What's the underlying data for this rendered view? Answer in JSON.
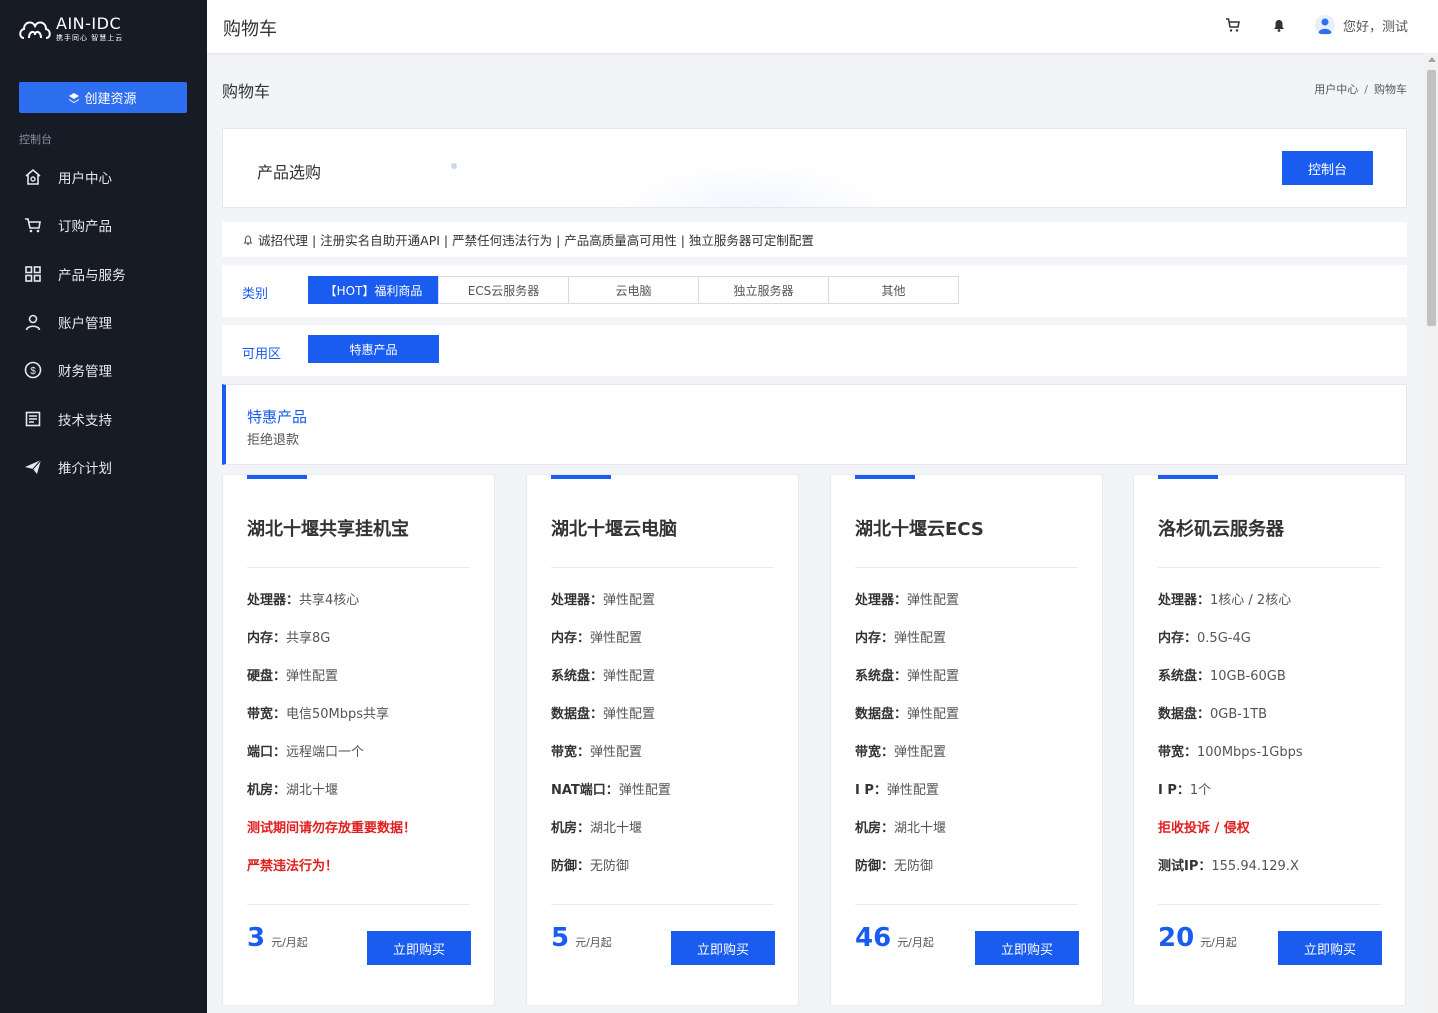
{
  "brand": {
    "title": "AIN-IDC",
    "subtitle": "携手同心 智慧上云"
  },
  "sidebar": {
    "create_label": "创建资源",
    "section": "控制台",
    "items": [
      {
        "label": "用户中心",
        "icon": "home-icon"
      },
      {
        "label": "订购产品",
        "icon": "cart-icon"
      },
      {
        "label": "产品与服务",
        "icon": "grid-icon"
      },
      {
        "label": "账户管理",
        "icon": "user-icon"
      },
      {
        "label": "财务管理",
        "icon": "dollar-icon"
      },
      {
        "label": "技术支持",
        "icon": "document-icon"
      },
      {
        "label": "推介计划",
        "icon": "send-icon"
      }
    ]
  },
  "header": {
    "title": "购物车",
    "greeting": "您好，测试"
  },
  "page": {
    "title": "购物车",
    "breadcrumb": [
      "用户中心",
      "购物车"
    ],
    "breadcrumb_sep": "/"
  },
  "product_select": {
    "title": "产品选购",
    "console_label": "控制台"
  },
  "notice": "诚招代理 | 注册实名自助开通API | 严禁任何违法行为 | 产品高质量高可用性 | 独立服务器可定制配置",
  "category": {
    "label": "类别",
    "tabs": [
      "【HOT】福利商品",
      "ECS云服务器",
      "云电脑",
      "独立服务器",
      "其他"
    ],
    "active": 0
  },
  "zone": {
    "label": "可用区",
    "tabs": [
      "特惠产品"
    ],
    "active": 0
  },
  "desc": {
    "title": "特惠产品",
    "subtitle": "拒绝退款"
  },
  "buy_label": "立即购买",
  "price_unit": "元/月起",
  "cards": [
    {
      "name": "湖北十堰共享挂机宝",
      "specs": [
        {
          "k": "处理器：",
          "v": "共享4核心"
        },
        {
          "k": "内存：",
          "v": "共享8G"
        },
        {
          "k": "硬盘：",
          "v": "弹性配置"
        },
        {
          "k": "带宽：",
          "v": "电信50Mbps共享"
        },
        {
          "k": "端口：",
          "v": "远程端口一个"
        },
        {
          "k": "机房：",
          "v": "湖北十堰"
        },
        {
          "red": "测试期间请勿存放重要数据！"
        },
        {
          "red": "严禁违法行为！"
        }
      ],
      "price": "3"
    },
    {
      "name": "湖北十堰云电脑",
      "specs": [
        {
          "k": "处理器：",
          "v": "弹性配置"
        },
        {
          "k": "内存：",
          "v": "弹性配置"
        },
        {
          "k": "系统盘：",
          "v": "弹性配置"
        },
        {
          "k": "数据盘：",
          "v": "弹性配置"
        },
        {
          "k": "带宽：",
          "v": "弹性配置"
        },
        {
          "k": "NAT端口：",
          "v": "弹性配置"
        },
        {
          "k": "机房：",
          "v": "湖北十堰"
        },
        {
          "k": "防御：",
          "v": "无防御"
        }
      ],
      "price": "5"
    },
    {
      "name": "湖北十堰云ECS",
      "specs": [
        {
          "k": "处理器：",
          "v": "弹性配置"
        },
        {
          "k": "内存：",
          "v": "弹性配置"
        },
        {
          "k": "系统盘：",
          "v": "弹性配置"
        },
        {
          "k": "数据盘：",
          "v": "弹性配置"
        },
        {
          "k": "带宽：",
          "v": "弹性配置"
        },
        {
          "k": "I P：",
          "v": "弹性配置"
        },
        {
          "k": "机房：",
          "v": "湖北十堰"
        },
        {
          "k": "防御：",
          "v": "无防御"
        }
      ],
      "price": "46"
    },
    {
      "name": "洛杉矶云服务器",
      "specs": [
        {
          "k": "处理器：",
          "v": "1核心 / 2核心"
        },
        {
          "k": "内存：",
          "v": "0.5G-4G"
        },
        {
          "k": "系统盘：",
          "v": "10GB-60GB"
        },
        {
          "k": "数据盘：",
          "v": "0GB-1TB"
        },
        {
          "k": "带宽：",
          "v": "100Mbps-1Gbps"
        },
        {
          "k": "I P：",
          "v": "1个"
        },
        {
          "red": "拒收投诉 / 侵权"
        },
        {
          "k": "测试IP：",
          "v": "155.94.129.X"
        }
      ],
      "price": "20"
    }
  ]
}
